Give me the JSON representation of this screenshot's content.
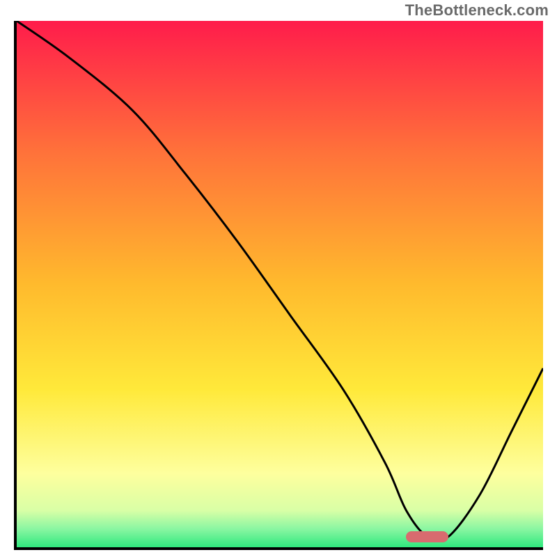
{
  "watermark": "TheBottleneck.com",
  "colors": {
    "gradient_top": "#ff1c4b",
    "gradient_mid_upper": "#ff8a2a",
    "gradient_mid": "#ffd92e",
    "gradient_pale": "#feff9e",
    "gradient_green": "#2fe97e",
    "curve_stroke": "#000000",
    "marker_fill": "#d86b6f",
    "axis": "#000000"
  },
  "chart_data": {
    "type": "line",
    "title": "",
    "xlabel": "",
    "ylabel": "",
    "xlim": [
      0,
      100
    ],
    "ylim": [
      0,
      100
    ],
    "grid": false,
    "legend": false,
    "series": [
      {
        "name": "bottleneck-curve",
        "x": [
          0,
          10,
          22,
          32,
          42,
          52,
          62,
          70,
          74,
          78,
          82,
          88,
          94,
          100
        ],
        "values": [
          100,
          93,
          83,
          71,
          58,
          44,
          30,
          16,
          7,
          2,
          2,
          10,
          22,
          34
        ]
      }
    ],
    "marker": {
      "x_start": 74,
      "x_end": 82,
      "y": 2,
      "color": "#d86b6f"
    },
    "background_gradient_stops": [
      {
        "pos": 0.0,
        "color": "#ff1c4b"
      },
      {
        "pos": 0.25,
        "color": "#ff723a"
      },
      {
        "pos": 0.5,
        "color": "#ffba2d"
      },
      {
        "pos": 0.7,
        "color": "#ffe93a"
      },
      {
        "pos": 0.86,
        "color": "#feff9e"
      },
      {
        "pos": 0.93,
        "color": "#d9ffa6"
      },
      {
        "pos": 0.965,
        "color": "#8af6a2"
      },
      {
        "pos": 1.0,
        "color": "#2fe97e"
      }
    ]
  }
}
